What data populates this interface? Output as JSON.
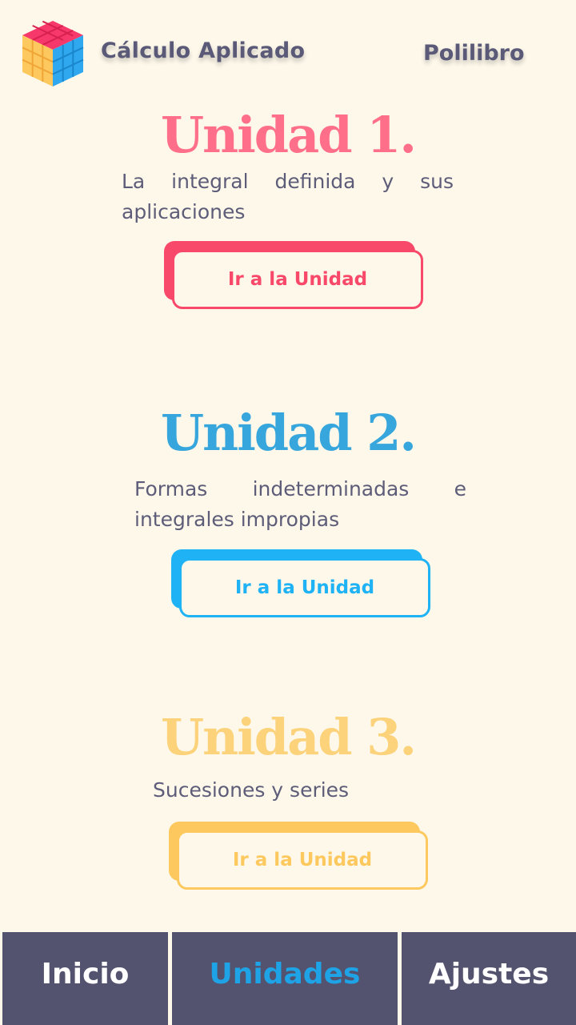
{
  "header": {
    "logo_icon": "rubiks-cube-icon",
    "app_title": "Cálculo Aplicado",
    "link_label": "Polilibro"
  },
  "units": [
    {
      "title": "Unidad 1.",
      "description": "La integral definida y sus aplicaciones",
      "button_label": "Ir a la Unidad",
      "color": "#f8496b"
    },
    {
      "title": "Unidad 2.",
      "description": "Formas indeterminadas e integrales impropias",
      "button_label": "Ir a la Unidad",
      "color": "#1fb3f5"
    },
    {
      "title": "Unidad 3.",
      "description": "Sucesiones y series",
      "button_label": "Ir a la Unidad",
      "color": "#fdc95e"
    }
  ],
  "tabbar": {
    "tabs": [
      {
        "label": "Inicio",
        "active": false
      },
      {
        "label": "Unidades",
        "active": true
      },
      {
        "label": "Ajustes",
        "active": false
      }
    ],
    "background": "#53536f",
    "active_color": "#1ea3e6"
  }
}
